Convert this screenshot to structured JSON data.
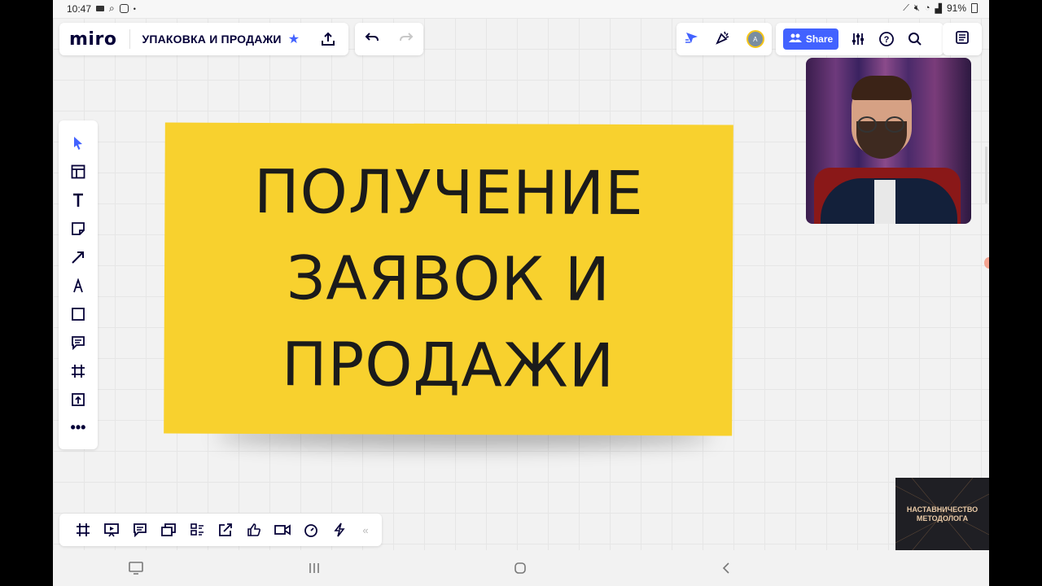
{
  "status_bar": {
    "time": "10:47",
    "battery": "91%"
  },
  "app": {
    "logo": "miro",
    "board_title": "УПАКОВКА И ПРОДАЖИ"
  },
  "header": {
    "share_label": "Share",
    "avatar_initial": "A"
  },
  "left_toolbar": {
    "items": [
      "select-icon",
      "templates-icon",
      "text-icon",
      "sticky-note-icon",
      "connection-line-icon",
      "pen-icon",
      "shape-icon",
      "comment-icon",
      "frame-icon",
      "upload-icon",
      "more-icon"
    ]
  },
  "bottom_toolbar": {
    "items": [
      "frames-icon",
      "presentation-icon",
      "comments-icon",
      "cards-icon",
      "kanban-icon",
      "export-icon",
      "voting-icon",
      "video-chat-icon",
      "timer-icon",
      "activity-icon"
    ],
    "collapse": "«"
  },
  "sticky_note": {
    "lines": [
      "ПОЛУЧЕНИЕ",
      "ЗАЯВОК И",
      "ПРОДАЖИ"
    ],
    "color": "#f8d12e"
  },
  "promo": {
    "title_line1": "НАСТАВНИЧЕСТВО",
    "title_line2": "МЕТОДОЛОГА"
  },
  "colors": {
    "accent": "#4262ff",
    "brand": "#050038"
  }
}
